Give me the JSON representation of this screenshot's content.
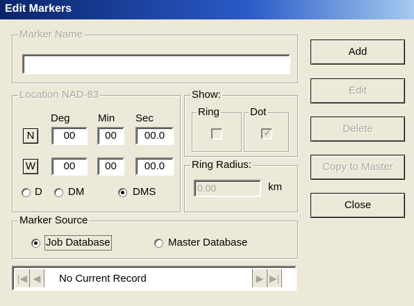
{
  "window": {
    "title": "Edit Markers"
  },
  "marker_name": {
    "legend": "Marker Name",
    "value": ""
  },
  "location": {
    "legend": "Location NAD-83",
    "headers": {
      "deg": "Deg",
      "min": "Min",
      "sec": "Sec"
    },
    "lat": {
      "hemisphere": "N",
      "deg": "00",
      "min": "00",
      "sec": "00.0"
    },
    "lon": {
      "hemisphere": "W",
      "deg": "00",
      "min": "00",
      "sec": "00.0"
    },
    "format_options": {
      "d": "D",
      "dm": "DM",
      "dms": "DMS"
    },
    "format_selected": "DMS"
  },
  "show": {
    "legend": "Show:",
    "ring": {
      "label": "Ring",
      "checked": false
    },
    "dot": {
      "label": "Dot",
      "checked": true
    }
  },
  "ring_radius": {
    "legend": "Ring Radius:",
    "placeholder": "0.00",
    "unit": "km"
  },
  "buttons": {
    "add": "Add",
    "edit": "Edit",
    "delete": "Delete",
    "copy_to_master": "Copy to Master",
    "close": "Close"
  },
  "marker_source": {
    "legend": "Marker Source",
    "options": {
      "job": "Job Database",
      "master": "Master Database"
    },
    "selected": "Job Database"
  },
  "navigator": {
    "status": "No Current Record"
  }
}
